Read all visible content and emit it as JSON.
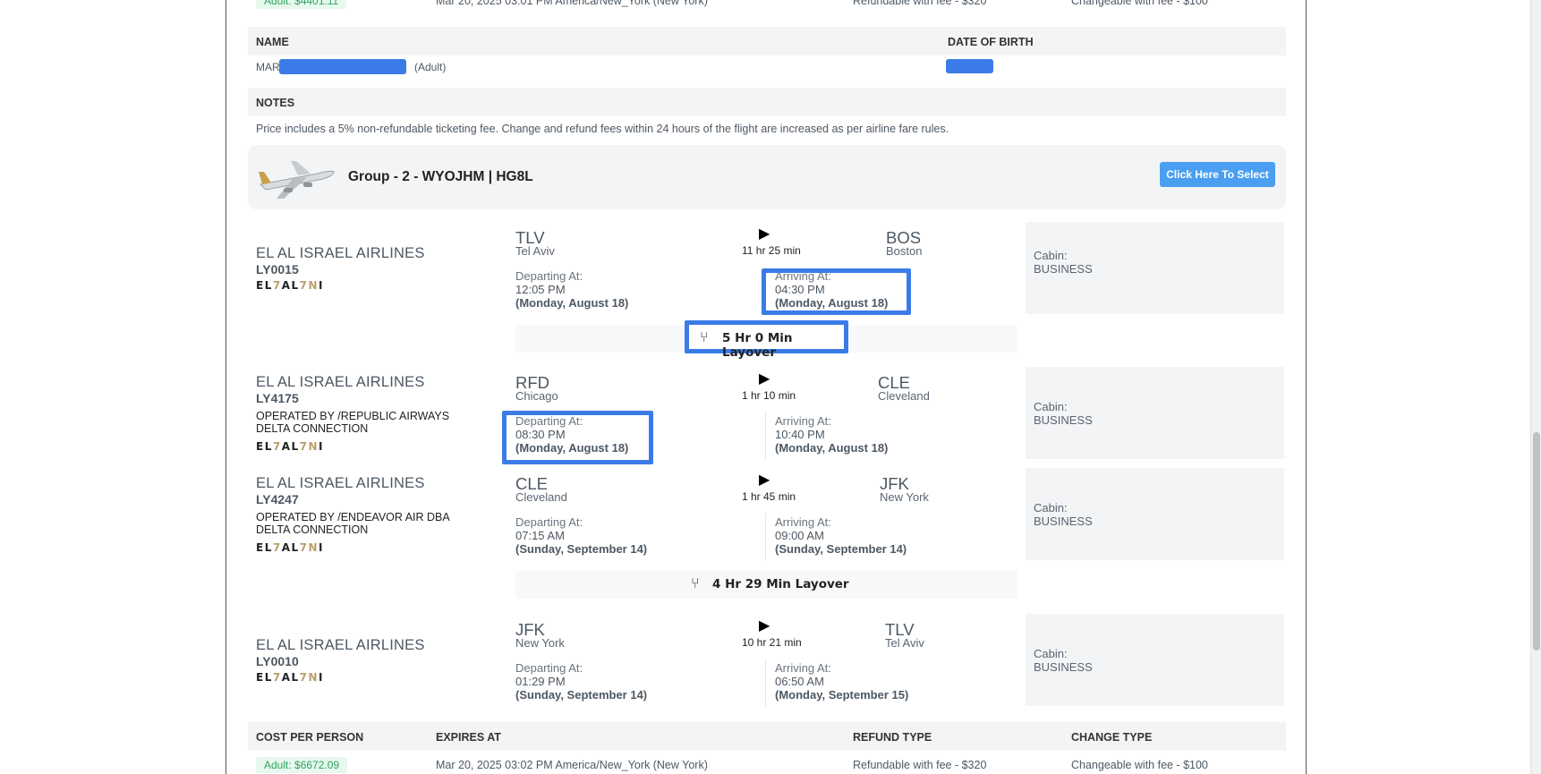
{
  "prev_row": {
    "cost": "Adult: $4401.11",
    "expires": "Mar 20, 2025 03:01 PM America/New_York (New York)",
    "refund": "Refundable with fee - $320",
    "change": "Changeable with fee - $100"
  },
  "passenger_table": {
    "name_header": "NAME",
    "dob_header": "DATE OF BIRTH",
    "name_prefix": "MAR",
    "name_suffix": "(Adult)"
  },
  "notes": {
    "header": "NOTES",
    "text": "Price includes a 5% non-refundable ticketing fee. Change and refund fees within 24 hours of the flight are increased as per airline fare rules."
  },
  "group": {
    "title": "Group - 2 - WYOJHM | HG8L",
    "select_label": "Click Here To Select"
  },
  "logo": {
    "a": "EL",
    "b": "7",
    "c": "AL",
    "d": "7N",
    "e": "I"
  },
  "labels": {
    "departing": "Departing At:",
    "arriving": "Arriving At:",
    "cabin": "Cabin:"
  },
  "segments": [
    {
      "airline": "EL AL ISRAEL AIRLINES",
      "flight": "LY0015",
      "operated": "",
      "from_code": "TLV",
      "from_city": "Tel Aviv",
      "to_code": "BOS",
      "to_city": "Boston",
      "duration": "11 hr 25 min",
      "dep_time": "12:05 PM",
      "dep_date": "(Monday, August 18)",
      "arr_time": "04:30 PM",
      "arr_date": "(Monday, August 18)",
      "cabin": "BUSINESS"
    },
    {
      "airline": "EL AL ISRAEL AIRLINES",
      "flight": "LY4175",
      "operated": "OPERATED BY /REPUBLIC AIRWAYS DELTA CONNECTION",
      "from_code": "RFD",
      "from_city": "Chicago",
      "to_code": "CLE",
      "to_city": "Cleveland",
      "duration": "1 hr 10 min",
      "dep_time": "08:30 PM",
      "dep_date": "(Monday, August 18)",
      "arr_time": "10:40 PM",
      "arr_date": "(Monday, August 18)",
      "cabin": "BUSINESS"
    },
    {
      "airline": "EL AL ISRAEL AIRLINES",
      "flight": "LY4247",
      "operated": "OPERATED BY /ENDEAVOR AIR DBA DELTA CONNECTION",
      "from_code": "CLE",
      "from_city": "Cleveland",
      "to_code": "JFK",
      "to_city": "New York",
      "duration": "1 hr 45 min",
      "dep_time": "07:15 AM",
      "dep_date": "(Sunday, September 14)",
      "arr_time": "09:00 AM",
      "arr_date": "(Sunday, September 14)",
      "cabin": "BUSINESS"
    },
    {
      "airline": "EL AL ISRAEL AIRLINES",
      "flight": "LY0010",
      "operated": "",
      "from_code": "JFK",
      "from_city": "New York",
      "to_code": "TLV",
      "to_city": "Tel Aviv",
      "duration": "10 hr 21 min",
      "dep_time": "01:29 PM",
      "dep_date": "(Sunday, September 14)",
      "arr_time": "06:50 AM",
      "arr_date": "(Monday, September 15)",
      "cabin": "BUSINESS"
    }
  ],
  "layovers": [
    "5 Hr 0 Min Layover",
    "4 Hr 29 Min Layover"
  ],
  "cost_table": {
    "h_cost": "COST PER PERSON",
    "h_expires": "EXPIRES AT",
    "h_refund": "REFUND TYPE",
    "h_change": "CHANGE TYPE",
    "cost": "Adult: $6672.09",
    "expires": "Mar 20, 2025 03:02 PM America/New_York (New York)",
    "refund": "Refundable with fee - $320",
    "change": "Changeable with fee - $100"
  }
}
